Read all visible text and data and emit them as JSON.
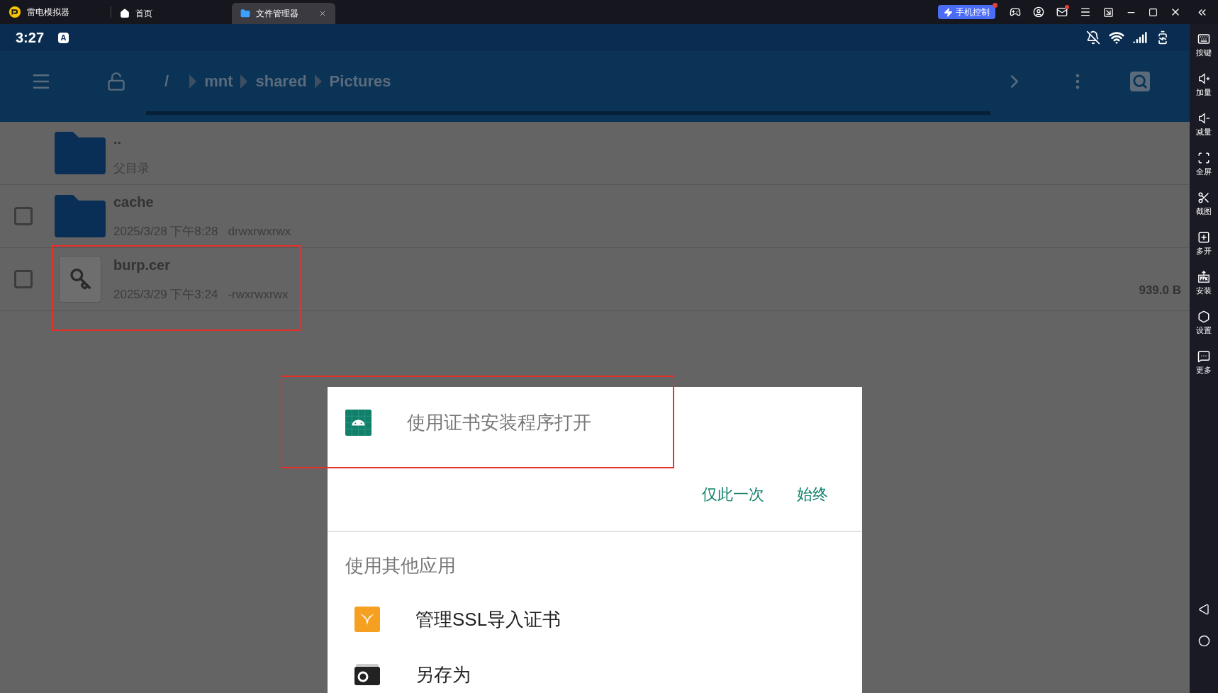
{
  "app": {
    "name": "雷电模拟器"
  },
  "tabs": [
    {
      "label": "首页",
      "kind": "home",
      "selected": false
    },
    {
      "label": "文件管理器",
      "kind": "folder",
      "selected": true
    }
  ],
  "top_bar": {
    "control_button": "手机控制"
  },
  "status_bar": {
    "time": "3:27",
    "input_indicator": "A"
  },
  "toolbar": {
    "path": [
      {
        "label": "/"
      },
      {
        "label": "mnt"
      },
      {
        "label": "shared"
      },
      {
        "label": "Pictures"
      }
    ]
  },
  "files": [
    {
      "kind": "parent",
      "name": "..",
      "details": "父目录",
      "highlighted": false
    },
    {
      "kind": "folder",
      "name": "cache",
      "modified": "2025/3/28 下午8:28",
      "permissions": "drwxrwxrwx",
      "checked": false,
      "highlighted": false
    },
    {
      "kind": "certificate",
      "name": "burp.cer",
      "modified": "2025/3/29 下午3:24",
      "permissions": "-rwxrwxrwx",
      "size": "939.0 B",
      "checked": false,
      "highlighted": true
    }
  ],
  "dialog": {
    "primary": {
      "label": "使用证书安装程序打开",
      "highlighted": true
    },
    "actions": [
      "仅此一次",
      "始终"
    ],
    "section_title": "使用其他应用",
    "apps": [
      {
        "label": "管理SSL导入证书",
        "kind": "ssl"
      },
      {
        "label": "另存为",
        "kind": "save"
      }
    ]
  },
  "side_panel": {
    "items": [
      {
        "label": "按键",
        "kind": "keys"
      },
      {
        "label": "加量",
        "kind": "volume_up"
      },
      {
        "label": "减量",
        "kind": "volume_down"
      },
      {
        "label": "全屏",
        "kind": "fullscreen"
      },
      {
        "label": "截图",
        "kind": "screenshot"
      },
      {
        "label": "多开",
        "kind": "multi"
      },
      {
        "label": "安装",
        "kind": "install"
      },
      {
        "label": "设置",
        "kind": "settings"
      },
      {
        "label": "更多",
        "kind": "more"
      }
    ]
  }
}
